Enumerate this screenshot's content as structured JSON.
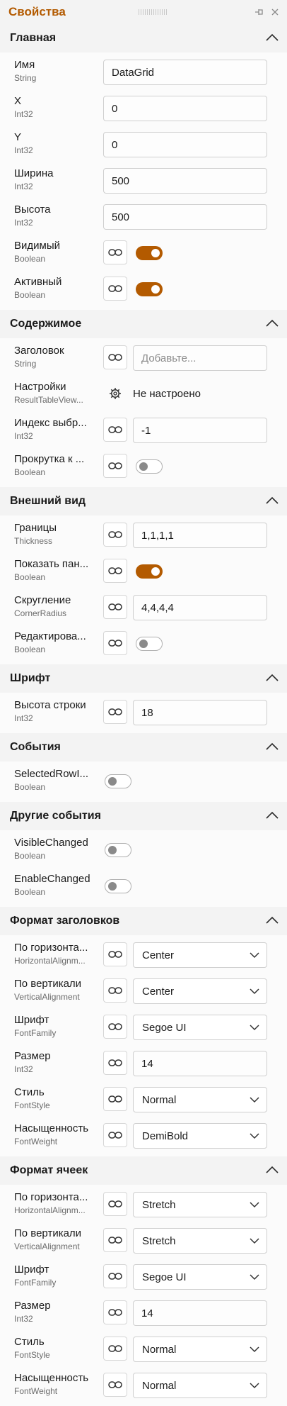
{
  "panel": {
    "title": "Свойства"
  },
  "sections": {
    "main": {
      "title": "Главная",
      "name": {
        "label": "Имя",
        "type": "String",
        "value": "DataGrid"
      },
      "x": {
        "label": "X",
        "type": "Int32",
        "value": "0"
      },
      "y": {
        "label": "Y",
        "type": "Int32",
        "value": "0"
      },
      "width": {
        "label": "Ширина",
        "type": "Int32",
        "value": "500"
      },
      "height": {
        "label": "Высота",
        "type": "Int32",
        "value": "500"
      },
      "visible": {
        "label": "Видимый",
        "type": "Boolean",
        "on": true
      },
      "enabled": {
        "label": "Активный",
        "type": "Boolean",
        "on": true
      }
    },
    "content": {
      "title": "Содержимое",
      "header": {
        "label": "Заголовок",
        "type": "String",
        "placeholder": "Добавьте..."
      },
      "settings": {
        "label": "Настройки",
        "type": "ResultTableView...",
        "value": "Не настроено"
      },
      "selected_index": {
        "label": "Индекс выбр...",
        "type": "Int32",
        "value": "-1"
      },
      "scroll": {
        "label": "Прокрутка к ...",
        "type": "Boolean",
        "on": false
      }
    },
    "appearance": {
      "title": "Внешний вид",
      "borders": {
        "label": "Границы",
        "type": "Thickness",
        "value": "1,1,1,1"
      },
      "show_panel": {
        "label": "Показать пан...",
        "type": "Boolean",
        "on": true
      },
      "rounding": {
        "label": "Скругление",
        "type": "CornerRadius",
        "value": "4,4,4,4"
      },
      "editable": {
        "label": "Редактирова...",
        "type": "Boolean",
        "on": false
      }
    },
    "font": {
      "title": "Шрифт",
      "row_height": {
        "label": "Высота строки",
        "type": "Int32",
        "value": "18"
      }
    },
    "events": {
      "title": "События",
      "selected_row": {
        "label": "SelectedRowI...",
        "type": "Boolean",
        "on": false
      }
    },
    "other_events": {
      "title": "Другие события",
      "visible_changed": {
        "label": "VisibleChanged",
        "type": "Boolean",
        "on": false
      },
      "enable_changed": {
        "label": "EnableChanged",
        "type": "Boolean",
        "on": false
      }
    },
    "header_format": {
      "title": "Формат заголовков",
      "h_align": {
        "label": "По горизонта...",
        "type": "HorizontalAlignm...",
        "value": "Center"
      },
      "v_align": {
        "label": "По вертикали",
        "type": "VerticalAlignment",
        "value": "Center"
      },
      "font_family": {
        "label": "Шрифт",
        "type": "FontFamily",
        "value": "Segoe UI"
      },
      "size": {
        "label": "Размер",
        "type": "Int32",
        "value": "14"
      },
      "style": {
        "label": "Стиль",
        "type": "FontStyle",
        "value": "Normal"
      },
      "weight": {
        "label": "Насыщенность",
        "type": "FontWeight",
        "value": "DemiBold"
      }
    },
    "cell_format": {
      "title": "Формат ячеек",
      "h_align": {
        "label": "По горизонта...",
        "type": "HorizontalAlignm...",
        "value": "Stretch"
      },
      "v_align": {
        "label": "По вертикали",
        "type": "VerticalAlignment",
        "value": "Stretch"
      },
      "font_family": {
        "label": "Шрифт",
        "type": "FontFamily",
        "value": "Segoe UI"
      },
      "size": {
        "label": "Размер",
        "type": "Int32",
        "value": "14"
      },
      "style": {
        "label": "Стиль",
        "type": "FontStyle",
        "value": "Normal"
      },
      "weight": {
        "label": "Насыщенность",
        "type": "FontWeight",
        "value": "Normal"
      }
    }
  },
  "colors": {
    "accent": "#b35a00",
    "background": "#f3f3f3",
    "section_body": "#fbfbfb"
  },
  "icons": {
    "bind": "link-icon",
    "collapse": "chevron-up-icon",
    "dropdown": "chevron-down-icon",
    "settings": "gear-icon",
    "pin": "pin-icon",
    "close": "close-icon"
  }
}
